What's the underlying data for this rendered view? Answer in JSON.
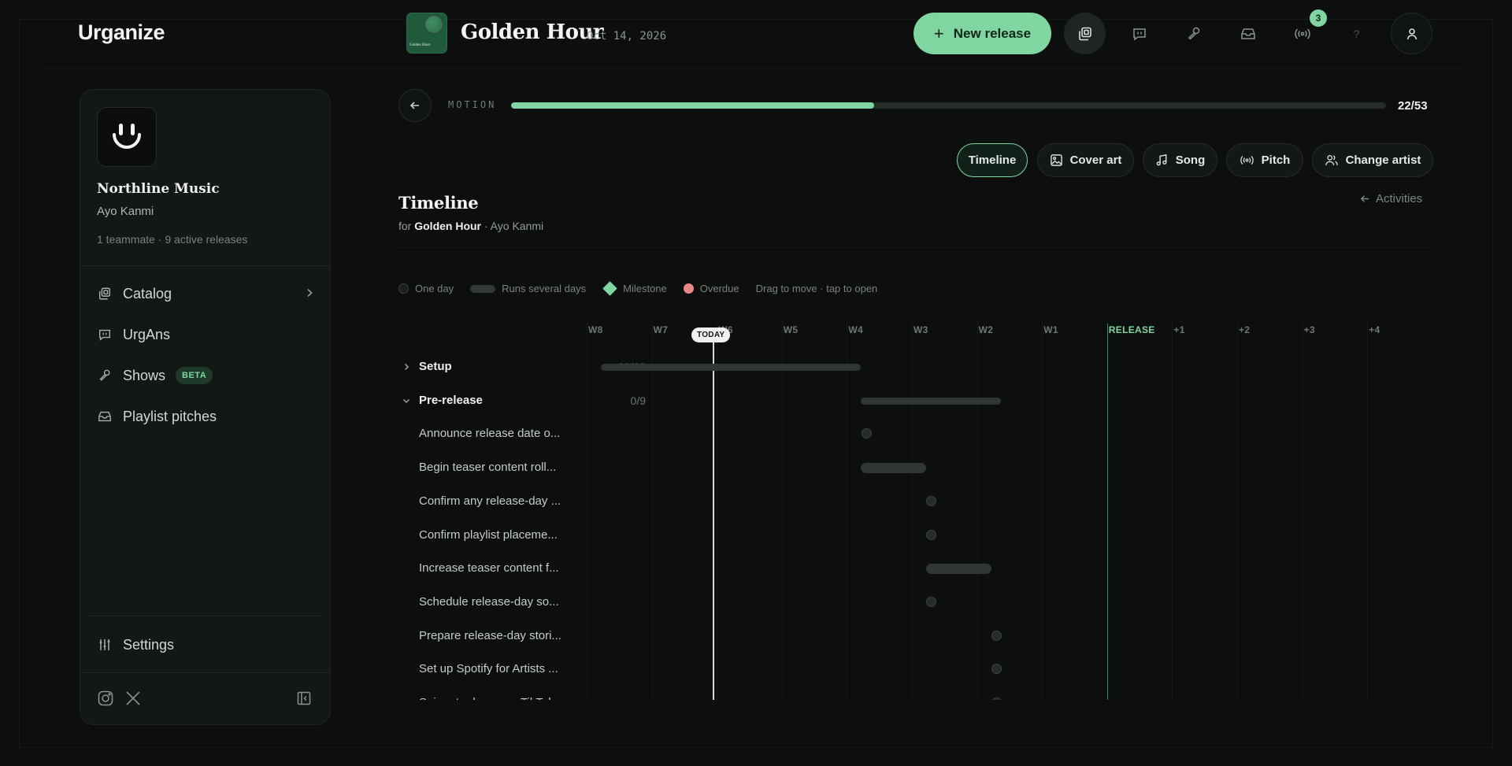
{
  "app": {
    "logo": "Urganize"
  },
  "release": {
    "cover_text": "Golden Hour",
    "title": "Golden Hour",
    "date": "Oct 14, 2026"
  },
  "header": {
    "new_release_label": "New release",
    "notification_count": "3",
    "help_label": "?",
    "icons": [
      "catalog-icon",
      "chat-icon",
      "microphone-icon",
      "inbox-icon",
      "broadcast-icon",
      "help-icon",
      "user-icon"
    ]
  },
  "sidebar": {
    "org_name": "Northline Music",
    "user": "Ayo Kanmi",
    "meta": "1 teammate · 9 active releases",
    "items": [
      {
        "label": "Catalog",
        "icon": "catalog-icon"
      },
      {
        "label": "UrgAns",
        "icon": "chat-icon"
      },
      {
        "label": "Shows",
        "icon": "microphone-icon",
        "badge": "BETA"
      },
      {
        "label": "Playlist pitches",
        "icon": "inbox-icon"
      }
    ],
    "settings_label": "Settings"
  },
  "progress": {
    "label": "MOTION",
    "count": "22/53",
    "fraction": 0.415
  },
  "tabs": [
    {
      "label": "Timeline",
      "active": true
    },
    {
      "label": "Cover art",
      "icon": "image-icon"
    },
    {
      "label": "Song",
      "icon": "music-note-icon"
    },
    {
      "label": "Pitch",
      "icon": "broadcast-icon"
    },
    {
      "label": "Change artist",
      "icon": "users-icon"
    }
  ],
  "section": {
    "title": "Timeline",
    "sub_prefix": "for",
    "sub_release": "Golden Hour",
    "sub_artist": "· Ayo Kanmi",
    "activities_label": "Activities"
  },
  "legend": {
    "one_day": "One day",
    "several_days": "Runs several days",
    "milestone": "Milestone",
    "overdue": "Overdue",
    "hint": "Drag to move · tap to open"
  },
  "timeline": {
    "weeks": [
      "W8",
      "W7",
      "W6",
      "W5",
      "W4",
      "W3",
      "W2",
      "W1",
      "RELEASE",
      "+1",
      "+2",
      "+3",
      "+4"
    ],
    "today_label": "TODAY",
    "groups": [
      {
        "label": "Setup",
        "count": "22/23",
        "expanded": false
      },
      {
        "label": "Pre-release",
        "count": "0/9",
        "expanded": true
      }
    ],
    "tasks": [
      "Announce release date o...",
      "Begin teaser content roll...",
      "Confirm any release-day ...",
      "Confirm playlist placeme...",
      "Increase teaser content f...",
      "Schedule release-day so...",
      "Prepare release-day stori...",
      "Set up Spotify for Artists ...",
      "Snippet release on TikTok..."
    ]
  },
  "colors": {
    "accent": "#7fd6a1",
    "background": "#0c0f0d",
    "overdue": "#e8888a"
  }
}
